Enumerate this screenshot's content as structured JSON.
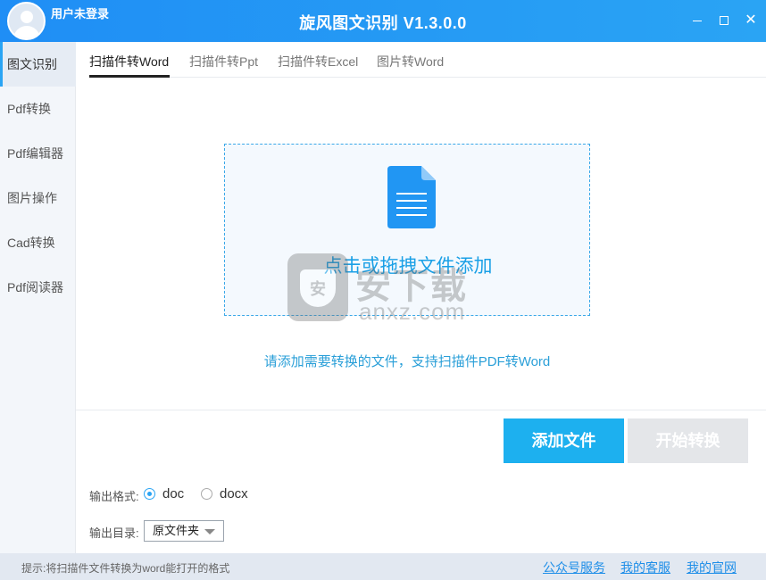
{
  "window": {
    "title": "旋风图文识别 V1.3.0.0",
    "user_label": "用户未登录"
  },
  "sidebar": {
    "items": [
      {
        "label": "图文识别",
        "active": true
      },
      {
        "label": "Pdf转换"
      },
      {
        "label": "Pdf编辑器"
      },
      {
        "label": "图片操作"
      },
      {
        "label": "Cad转换"
      },
      {
        "label": "Pdf阅读器"
      }
    ]
  },
  "tabs": [
    {
      "label": "扫描件转Word",
      "active": true
    },
    {
      "label": "扫描件转Ppt"
    },
    {
      "label": "扫描件转Excel"
    },
    {
      "label": "图片转Word"
    }
  ],
  "dropzone": {
    "text": "点击或拖拽文件添加",
    "icon": "document-icon",
    "hint": "请添加需要转换的文件，支持扫描件PDF转Word"
  },
  "watermark": {
    "shield_char": "安",
    "title": "安下载",
    "url": "anxz.com"
  },
  "actions": {
    "add_label": "添加文件",
    "start_label": "开始转换"
  },
  "output": {
    "format_label": "输出格式:",
    "formats": [
      {
        "label": "doc",
        "checked": true
      },
      {
        "label": "docx",
        "checked": false
      }
    ],
    "dir_label": "输出目录:",
    "dir_value": "原文件夹"
  },
  "statusbar": {
    "hint": "提示:将扫描件文件转换为word能打开的格式",
    "links": [
      "公众号服务",
      "我的客服",
      "我的官网"
    ]
  },
  "colors": {
    "accent": "#1db0ef",
    "titlebar": "#2aa4f4",
    "link": "#1e8ee8",
    "disabled": "#e4e6e9"
  }
}
